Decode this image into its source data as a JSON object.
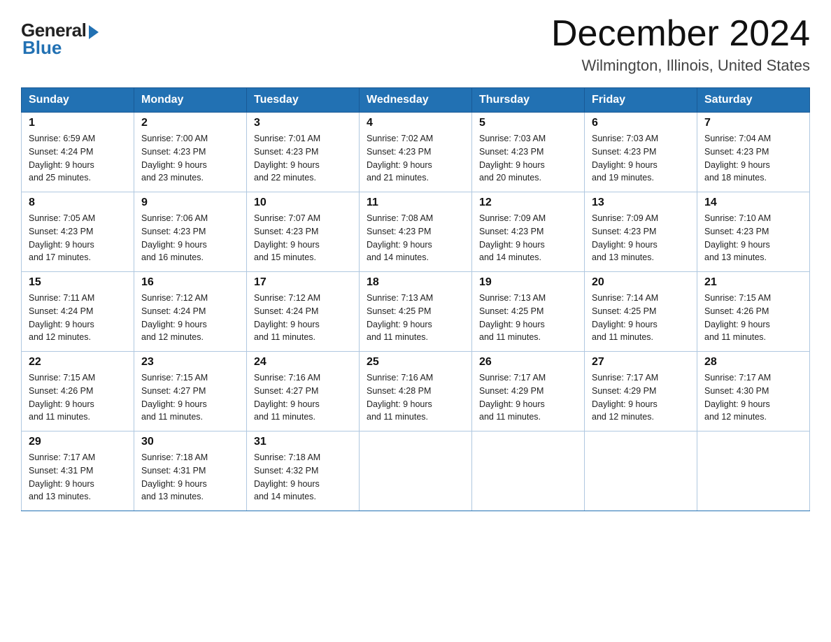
{
  "header": {
    "logo_general": "General",
    "logo_blue": "Blue",
    "month_title": "December 2024",
    "location": "Wilmington, Illinois, United States"
  },
  "days_of_week": [
    "Sunday",
    "Monday",
    "Tuesday",
    "Wednesday",
    "Thursday",
    "Friday",
    "Saturday"
  ],
  "weeks": [
    [
      {
        "day": "1",
        "sunrise": "6:59 AM",
        "sunset": "4:24 PM",
        "daylight": "9 hours and 25 minutes."
      },
      {
        "day": "2",
        "sunrise": "7:00 AM",
        "sunset": "4:23 PM",
        "daylight": "9 hours and 23 minutes."
      },
      {
        "day": "3",
        "sunrise": "7:01 AM",
        "sunset": "4:23 PM",
        "daylight": "9 hours and 22 minutes."
      },
      {
        "day": "4",
        "sunrise": "7:02 AM",
        "sunset": "4:23 PM",
        "daylight": "9 hours and 21 minutes."
      },
      {
        "day": "5",
        "sunrise": "7:03 AM",
        "sunset": "4:23 PM",
        "daylight": "9 hours and 20 minutes."
      },
      {
        "day": "6",
        "sunrise": "7:03 AM",
        "sunset": "4:23 PM",
        "daylight": "9 hours and 19 minutes."
      },
      {
        "day": "7",
        "sunrise": "7:04 AM",
        "sunset": "4:23 PM",
        "daylight": "9 hours and 18 minutes."
      }
    ],
    [
      {
        "day": "8",
        "sunrise": "7:05 AM",
        "sunset": "4:23 PM",
        "daylight": "9 hours and 17 minutes."
      },
      {
        "day": "9",
        "sunrise": "7:06 AM",
        "sunset": "4:23 PM",
        "daylight": "9 hours and 16 minutes."
      },
      {
        "day": "10",
        "sunrise": "7:07 AM",
        "sunset": "4:23 PM",
        "daylight": "9 hours and 15 minutes."
      },
      {
        "day": "11",
        "sunrise": "7:08 AM",
        "sunset": "4:23 PM",
        "daylight": "9 hours and 14 minutes."
      },
      {
        "day": "12",
        "sunrise": "7:09 AM",
        "sunset": "4:23 PM",
        "daylight": "9 hours and 14 minutes."
      },
      {
        "day": "13",
        "sunrise": "7:09 AM",
        "sunset": "4:23 PM",
        "daylight": "9 hours and 13 minutes."
      },
      {
        "day": "14",
        "sunrise": "7:10 AM",
        "sunset": "4:23 PM",
        "daylight": "9 hours and 13 minutes."
      }
    ],
    [
      {
        "day": "15",
        "sunrise": "7:11 AM",
        "sunset": "4:24 PM",
        "daylight": "9 hours and 12 minutes."
      },
      {
        "day": "16",
        "sunrise": "7:12 AM",
        "sunset": "4:24 PM",
        "daylight": "9 hours and 12 minutes."
      },
      {
        "day": "17",
        "sunrise": "7:12 AM",
        "sunset": "4:24 PM",
        "daylight": "9 hours and 11 minutes."
      },
      {
        "day": "18",
        "sunrise": "7:13 AM",
        "sunset": "4:25 PM",
        "daylight": "9 hours and 11 minutes."
      },
      {
        "day": "19",
        "sunrise": "7:13 AM",
        "sunset": "4:25 PM",
        "daylight": "9 hours and 11 minutes."
      },
      {
        "day": "20",
        "sunrise": "7:14 AM",
        "sunset": "4:25 PM",
        "daylight": "9 hours and 11 minutes."
      },
      {
        "day": "21",
        "sunrise": "7:15 AM",
        "sunset": "4:26 PM",
        "daylight": "9 hours and 11 minutes."
      }
    ],
    [
      {
        "day": "22",
        "sunrise": "7:15 AM",
        "sunset": "4:26 PM",
        "daylight": "9 hours and 11 minutes."
      },
      {
        "day": "23",
        "sunrise": "7:15 AM",
        "sunset": "4:27 PM",
        "daylight": "9 hours and 11 minutes."
      },
      {
        "day": "24",
        "sunrise": "7:16 AM",
        "sunset": "4:27 PM",
        "daylight": "9 hours and 11 minutes."
      },
      {
        "day": "25",
        "sunrise": "7:16 AM",
        "sunset": "4:28 PM",
        "daylight": "9 hours and 11 minutes."
      },
      {
        "day": "26",
        "sunrise": "7:17 AM",
        "sunset": "4:29 PM",
        "daylight": "9 hours and 11 minutes."
      },
      {
        "day": "27",
        "sunrise": "7:17 AM",
        "sunset": "4:29 PM",
        "daylight": "9 hours and 12 minutes."
      },
      {
        "day": "28",
        "sunrise": "7:17 AM",
        "sunset": "4:30 PM",
        "daylight": "9 hours and 12 minutes."
      }
    ],
    [
      {
        "day": "29",
        "sunrise": "7:17 AM",
        "sunset": "4:31 PM",
        "daylight": "9 hours and 13 minutes."
      },
      {
        "day": "30",
        "sunrise": "7:18 AM",
        "sunset": "4:31 PM",
        "daylight": "9 hours and 13 minutes."
      },
      {
        "day": "31",
        "sunrise": "7:18 AM",
        "sunset": "4:32 PM",
        "daylight": "9 hours and 14 minutes."
      },
      null,
      null,
      null,
      null
    ]
  ],
  "labels": {
    "sunrise": "Sunrise:",
    "sunset": "Sunset:",
    "daylight": "Daylight:"
  }
}
